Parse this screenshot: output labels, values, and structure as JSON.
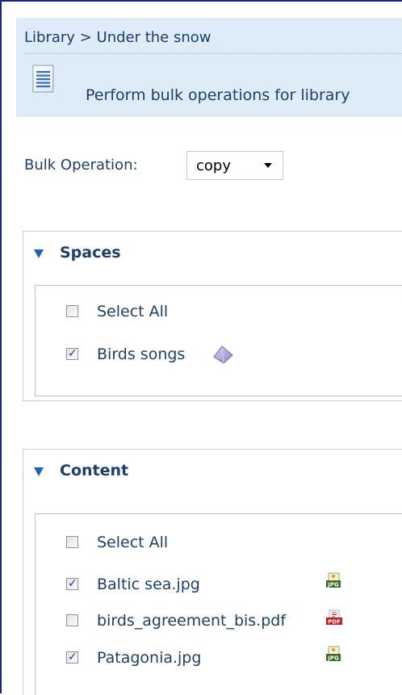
{
  "header": {
    "breadcrumb_root": "Library",
    "breadcrumb_separator": ">",
    "breadcrumb_current": "Under the snow",
    "description": "Perform bulk operations for library",
    "icon": "document-icon"
  },
  "bulk": {
    "label": "Bulk Operation:",
    "selected": "copy"
  },
  "spaces": {
    "title": "Spaces",
    "select_all_label": "Select All",
    "select_all_checked": false,
    "items": [
      {
        "label": "Birds songs",
        "checked": true,
        "icon": "space-icon"
      }
    ]
  },
  "content": {
    "title": "Content",
    "select_all_label": "Select All",
    "select_all_checked": false,
    "items": [
      {
        "label": "Baltic sea.jpg",
        "checked": true,
        "icon": "jpg-file-icon"
      },
      {
        "label": "birds_agreement_bis.pdf",
        "checked": false,
        "icon": "pdf-file-icon"
      },
      {
        "label": "Patagonia.jpg",
        "checked": true,
        "icon": "jpg-file-icon"
      }
    ]
  },
  "colors": {
    "header_bg": "#ddecf6",
    "text": "#1c3f6e",
    "accent": "#1e63c4",
    "frame_border": "#1a237e"
  }
}
